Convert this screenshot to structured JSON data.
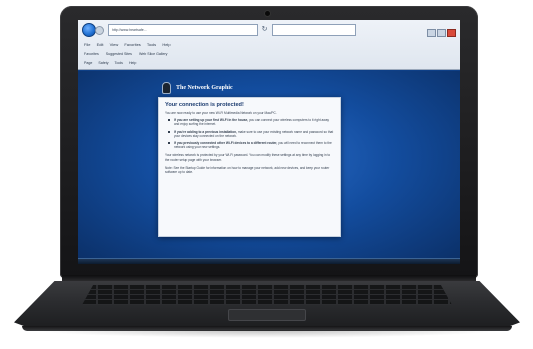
{
  "browser": {
    "address": "http://www.heartsafe...",
    "menu": [
      "File",
      "Edit",
      "View",
      "Favorites",
      "Tools",
      "Help"
    ],
    "favorites": [
      "Favorites",
      "Suggested Sites",
      "Web Slice Gallery"
    ],
    "commands": [
      "Page",
      "Safety",
      "Tools",
      "Help"
    ]
  },
  "page": {
    "brand": "The Network Graphic",
    "dialog": {
      "title": "Your connection is protected!",
      "intro": "You are now ready to use your new Wi-Fi Multimedia Network on your Mac/PC.",
      "items": [
        {
          "lead": "If you are setting up your first Wi-Fi in the house,",
          "text": "you can connect your wireless computers to it right away and enjoy surfing the internet."
        },
        {
          "lead": "If you're adding to a previous installation,",
          "text": "make sure to use your existing network name and password so that your devices stay connected on the network."
        },
        {
          "lead": "If you previously connected other Wi-Fi devices to a different router,",
          "text": "you will need to reconnect them to the network using your new settings."
        }
      ],
      "paragraphs": [
        "Your wireless network is protected by your Wi-Fi password. You can modify these settings at any time by logging in to the router setup page with your browser.",
        "Note: See the Startup Guide for information on how to manage your network, add new devices, and keep your router software up to date."
      ]
    }
  }
}
